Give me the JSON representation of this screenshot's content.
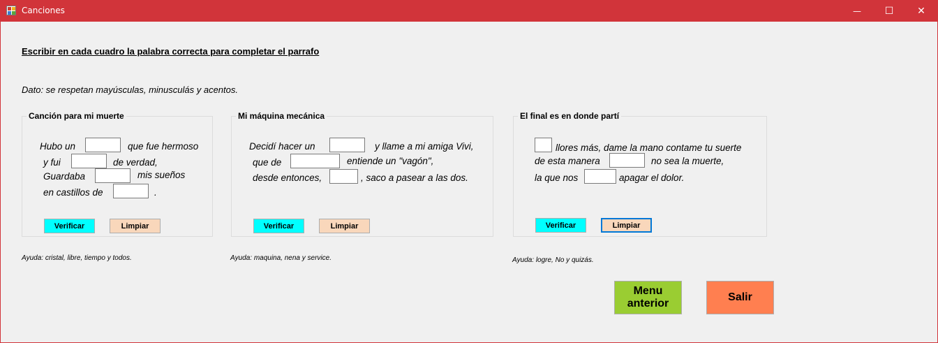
{
  "window": {
    "title": "Canciones",
    "minimize_glyph": "—",
    "maximize_glyph": "☐",
    "close_glyph": "✕",
    "icon": "app-form-icon"
  },
  "instructions": "Escribir en cada cuadro la palabra correcta para completar el parrafo",
  "dato": "Dato: se respetan mayúsculas, minusculás y acentos.",
  "groups": [
    {
      "title": "Canción para mi muerte",
      "line1a": "Hubo un",
      "line1b": "que fue hermoso",
      "line2a": "y fui",
      "line2b": "de verdad,",
      "line3a": "Guardaba",
      "line3b": "mis sueños",
      "line4a": "en castillos de",
      "line4b": ".",
      "verify_label": "Verificar",
      "clear_label": "Limpiar",
      "help": "Ayuda: cristal, libre, tiempo y todos."
    },
    {
      "title": "Mi máquina mecánica",
      "line1a": "Decidí hacer un",
      "line1b": "y llame a mi amiga Vivi,",
      "line2a": "que de",
      "line2b": "entiende un \"vagón\",",
      "line3a": "desde entonces,",
      "line3b": ", saco a pasear a las dos.",
      "verify_label": "Verificar",
      "clear_label": "Limpiar",
      "help": "Ayuda: maquina, nena y service."
    },
    {
      "title": "El final es en donde partí",
      "line1b": "llores más, dame la mano contame tu suerte",
      "line2a": "de esta manera",
      "line2b": "no sea la muerte,",
      "line3a": "la que nos",
      "line3b": "apagar el dolor.",
      "verify_label": "Verificar",
      "clear_label": "Limpiar",
      "help": "Ayuda: logre, No y quizás."
    }
  ],
  "buttons": {
    "menu_anterior_line1": "Menu",
    "menu_anterior_line2": "anterior",
    "salir": "Salir"
  },
  "colors": {
    "titlebar": "#d1343a",
    "verify": "#00ffff",
    "clear": "#f9d7bb",
    "menu": "#9acd32",
    "salir": "#ff7f50"
  }
}
